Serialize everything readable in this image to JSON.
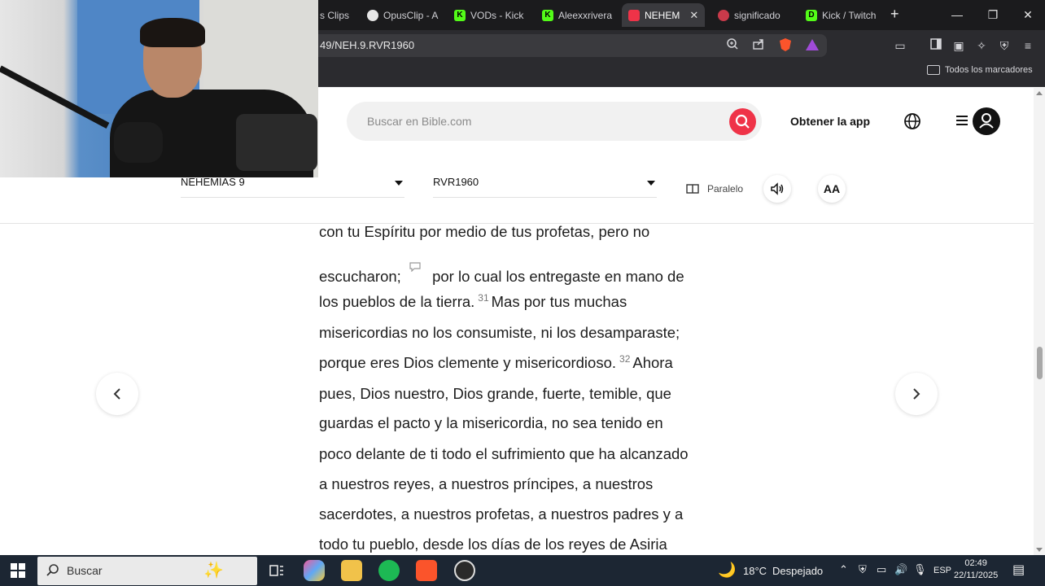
{
  "browser": {
    "tabs": [
      {
        "title": "s Clips",
        "favicon": "clips",
        "active": false
      },
      {
        "title": "OpusClip - A",
        "favicon": "opus",
        "active": false
      },
      {
        "title": "VODs - Kick",
        "favicon": "kick",
        "active": false
      },
      {
        "title": "Aleexxrivera",
        "favicon": "kick",
        "active": false
      },
      {
        "title": "NEHEM",
        "favicon": "bible",
        "active": true
      },
      {
        "title": "significado",
        "favicon": "circle",
        "active": false
      },
      {
        "title": "Kick / Twitch",
        "favicon": "kick-d",
        "active": false
      }
    ],
    "url": "49/NEH.9.RVR1960",
    "brave_badge": "4",
    "rewards_badge": "1",
    "bookmarks_folder": "Todos los marcadores"
  },
  "page": {
    "search_placeholder": "Buscar en Bible.com",
    "get_app": "Obtener la app",
    "book_selector": "NEHEMÍAS 9",
    "version_selector": "RVR1960",
    "parallel_label": "Paralelo",
    "font_button": "AA"
  },
  "verses": {
    "l1": "con tu Espíritu por medio de tus profetas, pero no",
    "l2a": "escucharon;",
    "l2b": "por lo cual los entregaste en mano de",
    "l3a": "los pueblos de la tierra.",
    "v31": "31",
    "l3b": "Mas por tus muchas",
    "l4": "misericordias no los consumiste, ni los desamparaste;",
    "l5a": "porque eres Dios clemente y misericordioso.",
    "v32": "32",
    "l5b": "Ahora",
    "l6": "pues, Dios nuestro, Dios grande, fuerte, temible, que",
    "l7": "guardas el pacto y la misericordia, no sea tenido en",
    "l8": "poco delante de ti todo el sufrimiento que ha alcanzado",
    "l9": "a nuestros reyes, a nuestros príncipes, a nuestros",
    "l10": "sacerdotes, a nuestros profetas, a nuestros padres y a",
    "l11": "todo tu pueblo, desde los días de los reyes de Asiria"
  },
  "taskbar": {
    "search_label": "Buscar",
    "weather_temp": "18°C",
    "weather_desc": "Despejado",
    "language": "ESP",
    "time": "02:49",
    "date": "22/11/2025"
  },
  "colors": {
    "accent_red": "#ef3348",
    "kick_green": "#53fc18"
  }
}
